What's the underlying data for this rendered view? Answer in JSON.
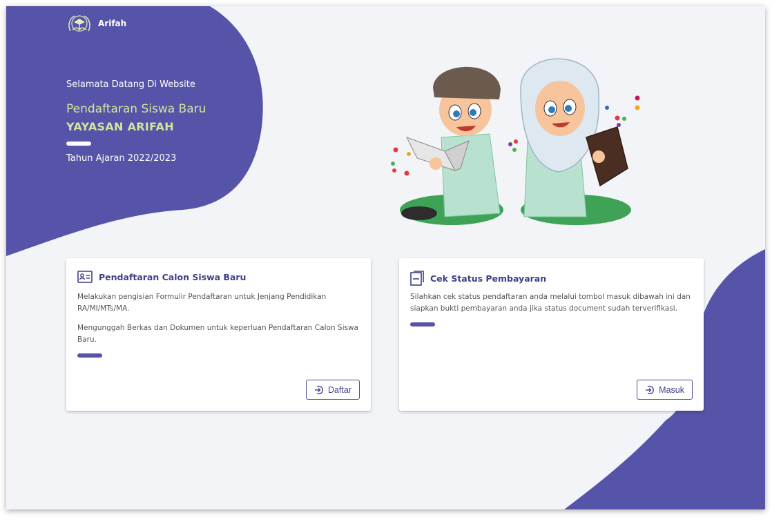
{
  "brand": {
    "name": "Arifah",
    "logo_icon": "school-emblem-icon"
  },
  "hero": {
    "welcome": "Selamata Datang Di Website",
    "line1": "Pendaftaran Siswa Baru",
    "line2": "YAYASAN ARIFAH",
    "year": "Tahun Ajaran 2022/2023"
  },
  "colors": {
    "accent": "#5654a8",
    "highlight": "#d3e59a",
    "background": "#f3f4f8"
  },
  "cards": [
    {
      "icon": "id-card-icon",
      "title": "Pendaftaran Calon Siswa Baru",
      "paragraphs": [
        "Melakukan pengisian Formulir Pendaftaran untuk Jenjang Pendidikan RA/MI/MTs/MA.",
        "Mengunggah Berkas dan Dokumen untuk keperluan Pendaftaran Calon Siswa Baru."
      ],
      "button": "Daftar"
    },
    {
      "icon": "document-icon",
      "title": "Cek Status Pembayaran",
      "paragraphs": [
        "Silahkan cek status pendaftaran anda melalui tombol masuk dibawah ini dan siapkan bukti pembayaran anda jika status document sudah terverifikasi."
      ],
      "button": "Masuk"
    }
  ]
}
